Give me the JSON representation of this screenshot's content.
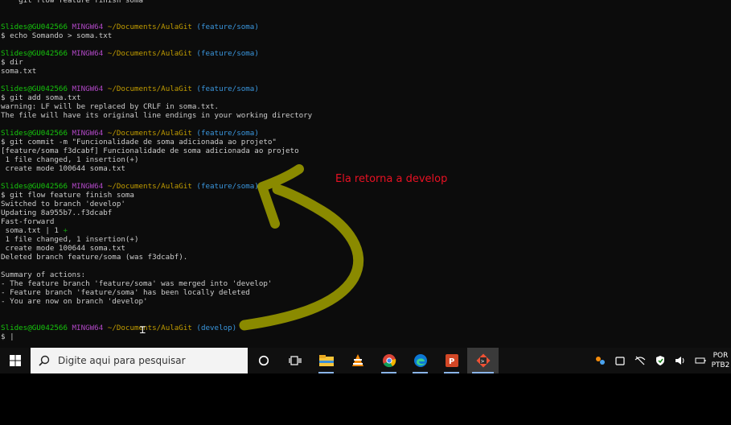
{
  "terminal": {
    "lines": [
      [
        {
          "t": "    git flow feature finish soma",
          "c": "txt"
        }
      ],
      [
        {
          "t": "",
          "c": "txt"
        }
      ],
      [
        {
          "t": "",
          "c": "txt"
        }
      ],
      [
        {
          "t": "Slides@GU042566 ",
          "c": "user"
        },
        {
          "t": "MINGW64 ",
          "c": "sys"
        },
        {
          "t": "~/Documents/AulaGit ",
          "c": "path"
        },
        {
          "t": "(feature/soma)",
          "c": "branch"
        }
      ],
      [
        {
          "t": "$ echo Somando > soma.txt",
          "c": "txt"
        }
      ],
      [
        {
          "t": "",
          "c": "txt"
        }
      ],
      [
        {
          "t": "Slides@GU042566 ",
          "c": "user"
        },
        {
          "t": "MINGW64 ",
          "c": "sys"
        },
        {
          "t": "~/Documents/AulaGit ",
          "c": "path"
        },
        {
          "t": "(feature/soma)",
          "c": "branch"
        }
      ],
      [
        {
          "t": "$ dir",
          "c": "txt"
        }
      ],
      [
        {
          "t": "soma.txt",
          "c": "txt"
        }
      ],
      [
        {
          "t": "",
          "c": "txt"
        }
      ],
      [
        {
          "t": "Slides@GU042566 ",
          "c": "user"
        },
        {
          "t": "MINGW64 ",
          "c": "sys"
        },
        {
          "t": "~/Documents/AulaGit ",
          "c": "path"
        },
        {
          "t": "(feature/soma)",
          "c": "branch"
        }
      ],
      [
        {
          "t": "$ git add soma.txt",
          "c": "txt"
        }
      ],
      [
        {
          "t": "warning: LF will be replaced by CRLF in soma.txt.",
          "c": "txt"
        }
      ],
      [
        {
          "t": "The file will have its original line endings in your working directory",
          "c": "txt"
        }
      ],
      [
        {
          "t": "",
          "c": "txt"
        }
      ],
      [
        {
          "t": "Slides@GU042566 ",
          "c": "user"
        },
        {
          "t": "MINGW64 ",
          "c": "sys"
        },
        {
          "t": "~/Documents/AulaGit ",
          "c": "path"
        },
        {
          "t": "(feature/soma)",
          "c": "branch"
        }
      ],
      [
        {
          "t": "$ git commit -m \"Funcionalidade de soma adicionada ao projeto\"",
          "c": "txt"
        }
      ],
      [
        {
          "t": "[feature/soma f3dcabf] Funcionalidade de soma adicionada ao projeto",
          "c": "txt"
        }
      ],
      [
        {
          "t": " 1 file changed, 1 insertion(+)",
          "c": "txt"
        }
      ],
      [
        {
          "t": " create mode 100644 soma.txt",
          "c": "txt"
        }
      ],
      [
        {
          "t": "",
          "c": "txt"
        }
      ],
      [
        {
          "t": "Slides@GU042566 ",
          "c": "user"
        },
        {
          "t": "MINGW64 ",
          "c": "sys"
        },
        {
          "t": "~/Documents/AulaGit ",
          "c": "path"
        },
        {
          "t": "(feature/soma)",
          "c": "branch"
        }
      ],
      [
        {
          "t": "$ git flow feature finish soma",
          "c": "txt"
        }
      ],
      [
        {
          "t": "Switched to branch 'develop'",
          "c": "txt"
        }
      ],
      [
        {
          "t": "Updating 8a955b7..f3dcabf",
          "c": "txt"
        }
      ],
      [
        {
          "t": "Fast-forward",
          "c": "txt"
        }
      ],
      [
        {
          "t": " soma.txt | 1 ",
          "c": "txt"
        },
        {
          "t": "+",
          "c": "plus"
        }
      ],
      [
        {
          "t": " 1 file changed, 1 insertion(+)",
          "c": "txt"
        }
      ],
      [
        {
          "t": " create mode 100644 soma.txt",
          "c": "txt"
        }
      ],
      [
        {
          "t": "Deleted branch feature/soma (was f3dcabf).",
          "c": "txt"
        }
      ],
      [
        {
          "t": "",
          "c": "txt"
        }
      ],
      [
        {
          "t": "Summary of actions:",
          "c": "txt"
        }
      ],
      [
        {
          "t": "- The feature branch 'feature/soma' was merged into 'develop'",
          "c": "txt"
        }
      ],
      [
        {
          "t": "- Feature branch 'feature/soma' has been locally deleted",
          "c": "txt"
        }
      ],
      [
        {
          "t": "- You are now on branch 'develop'",
          "c": "txt"
        }
      ],
      [
        {
          "t": "",
          "c": "txt"
        }
      ],
      [
        {
          "t": "",
          "c": "txt"
        }
      ],
      [
        {
          "t": "Slides@GU042566 ",
          "c": "user"
        },
        {
          "t": "MINGW64 ",
          "c": "sys"
        },
        {
          "t": "~/Documents/AulaGit ",
          "c": "path"
        },
        {
          "t": "(develop)",
          "c": "branch"
        }
      ],
      [
        {
          "t": "$ |",
          "c": "txt"
        }
      ]
    ]
  },
  "annotation": {
    "text": "Ela retorna a develop",
    "text_color": "#e81123",
    "arrow_color": "#8a8a00"
  },
  "taskbar": {
    "search_placeholder": "Digite aqui para pesquisar",
    "apps": [
      {
        "name": "cortana-icon",
        "state": ""
      },
      {
        "name": "task-view-icon",
        "state": ""
      },
      {
        "name": "file-explorer-icon",
        "state": "running"
      },
      {
        "name": "vlc-icon",
        "state": ""
      },
      {
        "name": "chrome-icon",
        "state": "running"
      },
      {
        "name": "edge-icon",
        "state": "running"
      },
      {
        "name": "powerpoint-icon",
        "state": "running"
      },
      {
        "name": "git-bash-icon",
        "state": "focused"
      }
    ],
    "language": {
      "line1": "POR",
      "line2": "PTB2"
    }
  }
}
